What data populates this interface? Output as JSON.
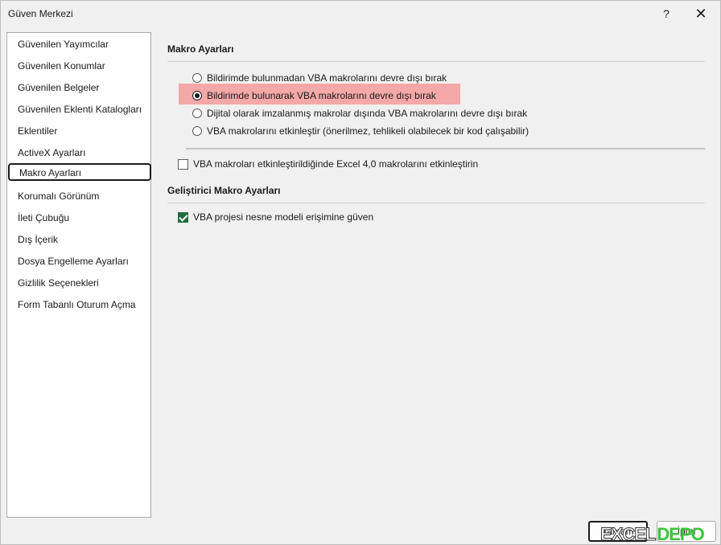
{
  "window": {
    "title": "Güven Merkezi",
    "help_label": "?",
    "close_label": "✕"
  },
  "sidebar": {
    "items": [
      {
        "label": "Güvenilen Yayımcılar"
      },
      {
        "label": "Güvenilen Konumlar"
      },
      {
        "label": "Güvenilen Belgeler"
      },
      {
        "label": "Güvenilen Eklenti Katalogları"
      },
      {
        "label": "Eklentiler"
      },
      {
        "label": "ActiveX Ayarları"
      },
      {
        "label": "Makro Ayarları",
        "selected": true
      },
      {
        "label": "Korumalı Görünüm"
      },
      {
        "label": "İleti Çubuğu"
      },
      {
        "label": "Dış İçerik"
      },
      {
        "label": "Dosya Engelleme Ayarları"
      },
      {
        "label": "Gizlilik Seçenekleri"
      },
      {
        "label": "Form Tabanlı Oturum Açma"
      }
    ]
  },
  "macro_settings": {
    "title": "Makro Ayarları",
    "options": [
      {
        "label": "Bildirimde bulunmadan VBA makrolarını devre dışı bırak",
        "checked": false
      },
      {
        "label": "Bildirimde bulunarak VBA makrolarını devre dışı bırak",
        "checked": true
      },
      {
        "label": "Dijital olarak imzalanmış makrolar dışında VBA makrolarını devre dışı bırak",
        "checked": false
      },
      {
        "label": "VBA makrolarını etkinleştir (önerilmez, tehlikeli olabilecek bir kod çalışabilir)",
        "checked": false
      }
    ],
    "excel4_checkbox": {
      "label": "VBA makroları etkinleştirildiğinde Excel 4,0 makrolarını etkinleştirin",
      "checked": false
    }
  },
  "developer_settings": {
    "title": "Geliştirici Makro Ayarları",
    "vba_trust": {
      "label": "VBA projesi nesne modeli erişimine güven",
      "checked": true
    }
  },
  "footer": {
    "ok_label": "Tamam",
    "cancel_label": "İptal"
  },
  "watermark": {
    "excel": "EXCEL",
    "depo": "DEPO"
  },
  "colors": {
    "highlight": "#f4a0a0",
    "checkbox_checked": "#1e6e3e",
    "watermark_green": "#3cc43c"
  }
}
